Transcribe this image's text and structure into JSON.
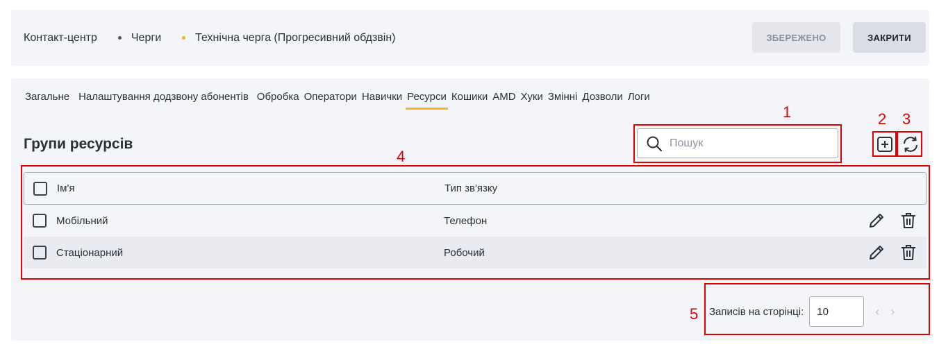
{
  "breadcrumbs": [
    "Контакт-центр",
    "Черги",
    "Технічна черга (Прогресивний обдзвін)"
  ],
  "header": {
    "saved_label": "ЗБЕРЕЖЕНО",
    "close_label": "ЗАКРИТИ"
  },
  "tabs": [
    {
      "label": "Загальне"
    },
    {
      "label": "Налаштування додзвону абонентів"
    },
    {
      "label": "Обробка"
    },
    {
      "label": "Оператори"
    },
    {
      "label": "Навички"
    },
    {
      "label": "Ресурси",
      "active": true
    },
    {
      "label": "Кошики"
    },
    {
      "label": "AMD"
    },
    {
      "label": "Хуки"
    },
    {
      "label": "Змінні"
    },
    {
      "label": "Дозволи"
    },
    {
      "label": "Логи"
    }
  ],
  "section": {
    "title": "Групи ресурсів"
  },
  "search": {
    "placeholder": "Пошук",
    "value": ""
  },
  "table": {
    "columns": [
      "Ім'я",
      "Тип зв'язку"
    ],
    "rows": [
      {
        "name": "Мобільний",
        "type": "Телефон"
      },
      {
        "name": "Стаціонарний",
        "type": "Робочий"
      }
    ]
  },
  "pagination": {
    "label": "Записів на сторінці:",
    "page_size": "10",
    "prev": "‹",
    "next": "›"
  },
  "annotations": [
    "1",
    "2",
    "3",
    "4",
    "5"
  ],
  "colors": {
    "accent": "#f0b429",
    "annotation": "#e00000",
    "card_bg": "#f4f5f8"
  }
}
